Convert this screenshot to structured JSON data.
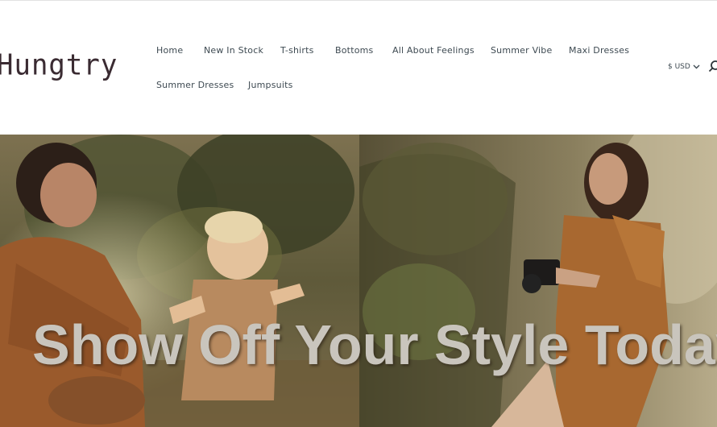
{
  "brand": {
    "logo_text": "Hungtry"
  },
  "nav": {
    "items": [
      {
        "label": "Home"
      },
      {
        "label": "New In Stock"
      },
      {
        "label": "T-shirts"
      },
      {
        "label": "Bottoms"
      },
      {
        "label": "All About Feelings"
      },
      {
        "label": "Summer Vibe"
      },
      {
        "label": "Maxi Dresses"
      },
      {
        "label": "Summer Dresses"
      },
      {
        "label": "Jumpsuits"
      }
    ]
  },
  "currency": {
    "label": "$ USD",
    "icon": "chevron-down-icon"
  },
  "search": {
    "icon": "search-icon"
  },
  "hero": {
    "headline": "Show Off Your Style Today!",
    "left_image": "mother-and-child-outdoor-photo",
    "right_image": "woman-with-camera-outdoor-photo"
  },
  "colors": {
    "nav_text": "#3e4a52",
    "logo": "#3a2b32",
    "headline": "#c9c5bd"
  }
}
